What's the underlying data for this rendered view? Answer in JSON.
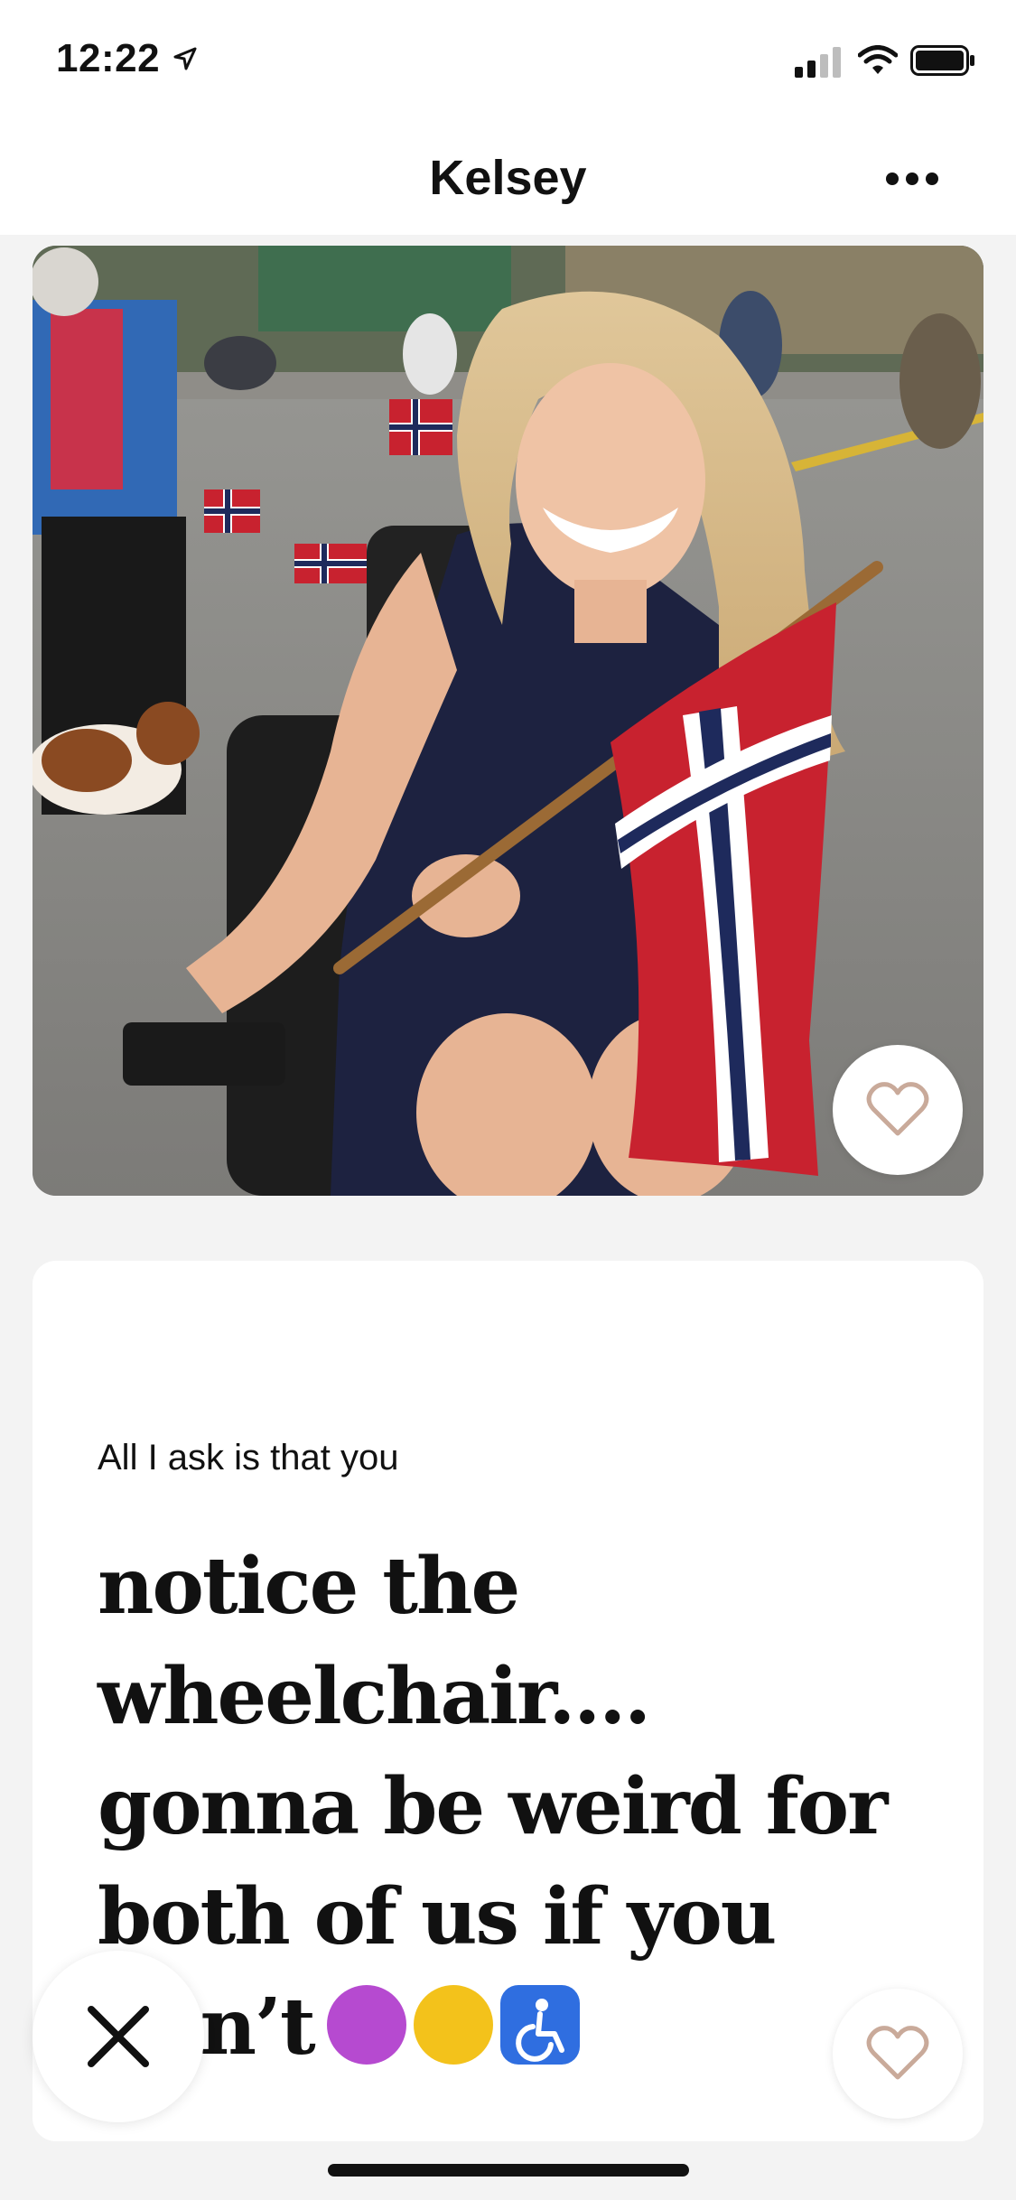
{
  "status_bar": {
    "time": "12:22",
    "icons": [
      "location-arrow-icon",
      "cellular-signal-icon",
      "wifi-icon",
      "battery-icon"
    ]
  },
  "header": {
    "title": "Kelsey",
    "more_icon": "more-horizontal-icon"
  },
  "photo": {
    "like_icon": "heart-outline-icon"
  },
  "prompt": {
    "label": "All I ask is that you",
    "answer": "notice the wheelchair.... gonna be weird for both of us if you don’t",
    "emojis": [
      "person-shrugging-emoji",
      "woozy-face-emoji",
      "wheelchair-symbol-emoji"
    ]
  },
  "actions": {
    "skip_icon": "x-close-icon",
    "like_icon": "heart-outline-icon"
  },
  "colors": {
    "background": "#f3f3f3",
    "card": "#ffffff",
    "heart": "#c9aa9a",
    "text": "#111111"
  }
}
